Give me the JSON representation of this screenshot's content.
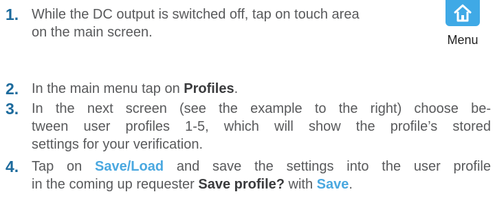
{
  "steps": [
    {
      "number": "1.",
      "lines": [
        "While the DC output is switched off, tap on touch area",
        "on the main screen."
      ]
    },
    {
      "number": "2.",
      "prefix": "In the main menu tap on ",
      "bold": "Profiles",
      "suffix": "."
    },
    {
      "number": "3.",
      "lines": [
        "In the next screen (see the example to the right) choose be-",
        "tween user profiles 1-5, which will show the profile’s stored",
        "settings for your verification."
      ]
    },
    {
      "number": "4.",
      "line1_prefix": "Tap on ",
      "line1_blue": "Save/Load",
      "line1_suffix": " and save the settings into the user profile",
      "line2_prefix": "in the coming up requester ",
      "line2_bold": "Save profile?",
      "line2_mid": " with ",
      "line2_blue": "Save",
      "line2_suffix": "."
    }
  ],
  "menu_icon": {
    "icon": "home-icon",
    "label": "Menu",
    "color": "#3fa9e6"
  },
  "colors": {
    "number": "#1c6a9c",
    "text": "#58595b",
    "highlight": "#4aa8e0"
  }
}
